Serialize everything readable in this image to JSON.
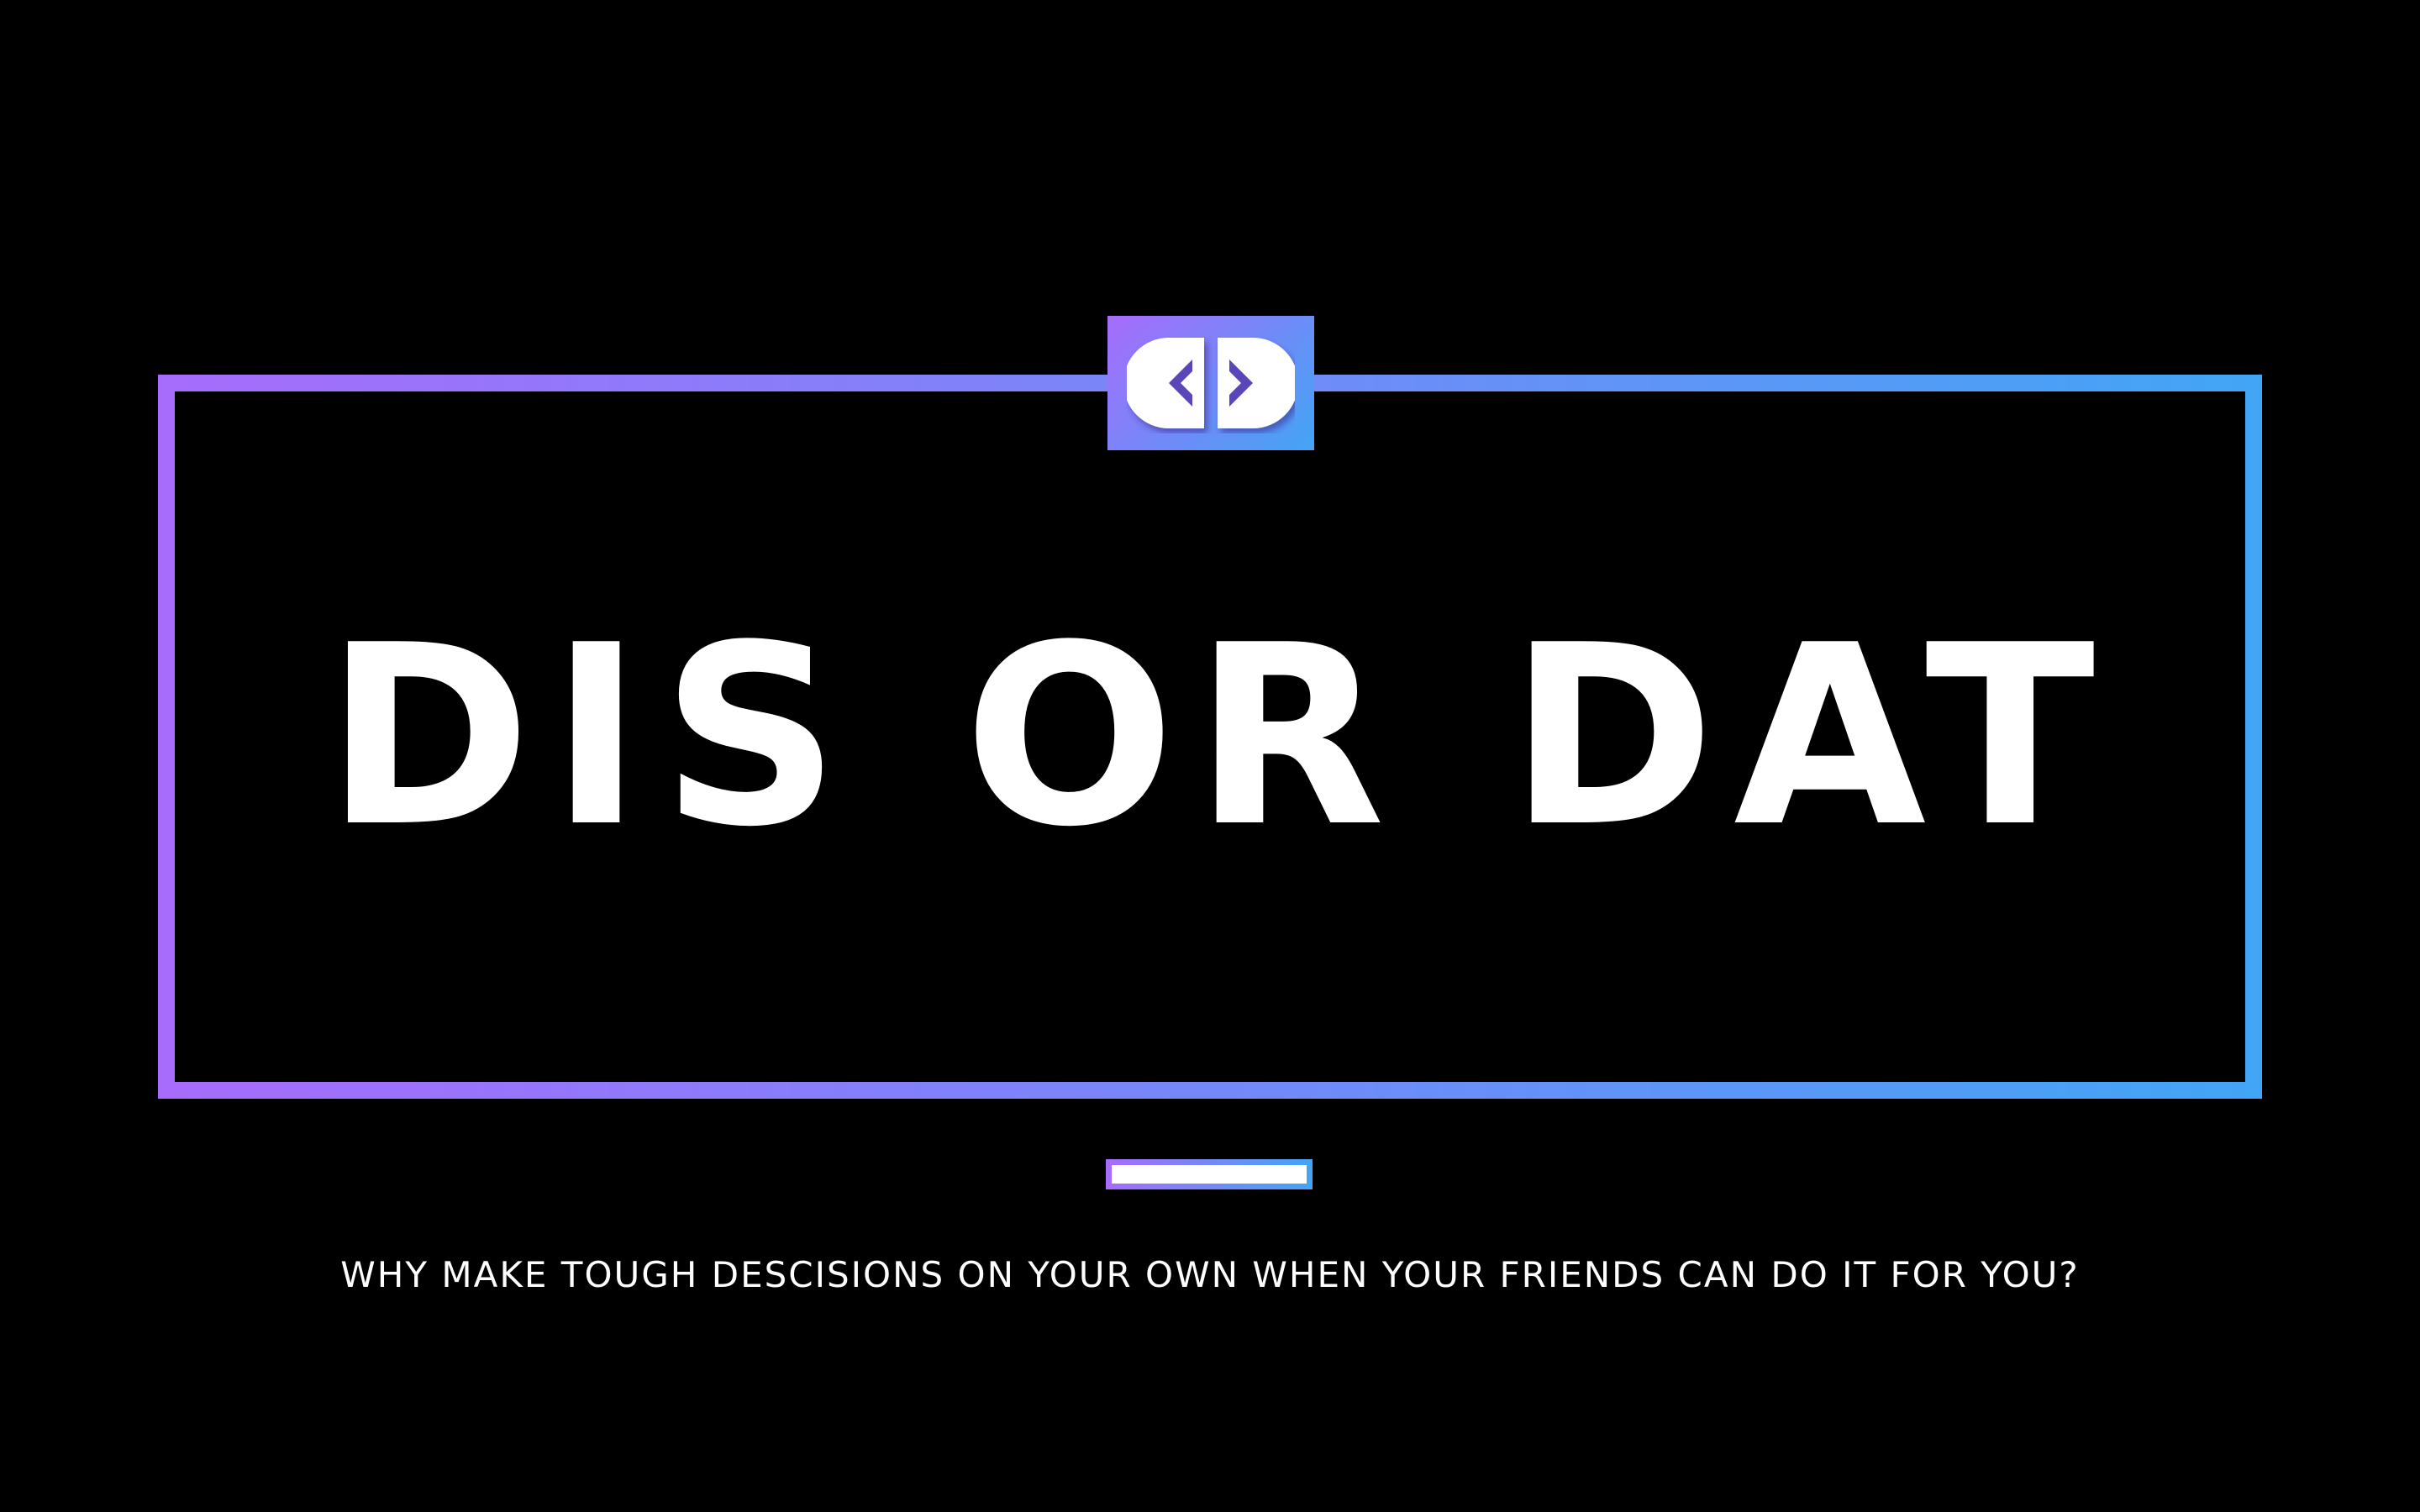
{
  "colors": {
    "background": "#000000",
    "gradient_start": "#a76cfb",
    "gradient_end": "#42a5f5",
    "text": "#ffffff"
  },
  "logo": {
    "icon": "left-right-arrows-logo-icon"
  },
  "title": "DIS OR DAT",
  "tagline": "WHY MAKE TOUGH DESCISIONS ON YOUR OWN WHEN YOUR FRIENDS CAN DO IT FOR YOU?"
}
